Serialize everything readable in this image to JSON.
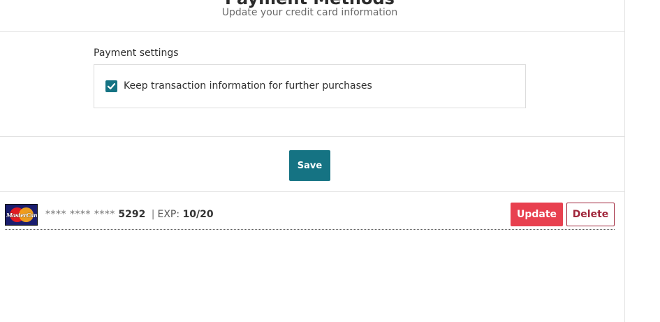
{
  "header": {
    "title": "Payment Methods",
    "subtitle": "Update your credit card information"
  },
  "settings": {
    "label": "Payment settings",
    "keep_transaction": {
      "label": "Keep transaction information for further purchases",
      "checked": true
    }
  },
  "actions": {
    "save_label": "Save"
  },
  "cards": [
    {
      "brand_text": "MasterCard",
      "masked_number": "**** **** ****",
      "last4": "5292",
      "separator": "|",
      "exp_label": "EXP:",
      "exp_value": "10/20",
      "update_label": "Update",
      "delete_label": "Delete"
    }
  ],
  "colors": {
    "primary": "#157383",
    "update": "#e8404f",
    "delete": "#a0253a"
  },
  "icons": {
    "checkbox": "checkmark-icon",
    "card_brand": "mastercard-icon"
  }
}
